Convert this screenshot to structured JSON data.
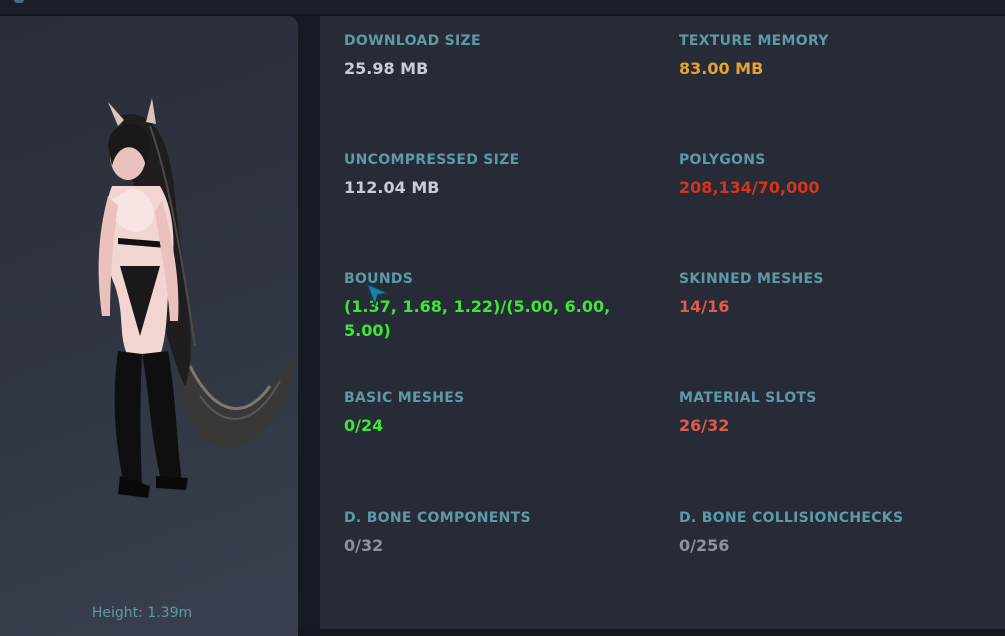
{
  "preview": {
    "height_label": "Height: 1.39m"
  },
  "stats": [
    {
      "label": "DOWNLOAD SIZE",
      "value": "25.98 MB",
      "color": "#c9ccd4"
    },
    {
      "label": "TEXTURE MEMORY",
      "value": "83.00 MB",
      "color": "#e0a532"
    },
    {
      "label": "UNCOMPRESSED SIZE",
      "value": "112.04 MB",
      "color": "#c9ccd4"
    },
    {
      "label": "POLYGONS",
      "value": "208,134/70,000",
      "color": "#d8341c"
    },
    {
      "label": "BOUNDS",
      "value": "(1.37, 1.68, 1.22)/(5.00, 6.00, 5.00)",
      "color": "#3ee636"
    },
    {
      "label": "SKINNED MESHES",
      "value": "14/16",
      "color": "#e35a47"
    },
    {
      "label": "BASIC MESHES",
      "value": "0/24",
      "color": "#3ee636"
    },
    {
      "label": "MATERIAL SLOTS",
      "value": "26/32",
      "color": "#e35a47"
    },
    {
      "label": "D. BONE COMPONENTS",
      "value": "0/32",
      "color": "#8e929a"
    },
    {
      "label": "D. BONE COLLISIONCHECKS",
      "value": "0/256",
      "color": "#8e929a"
    }
  ]
}
